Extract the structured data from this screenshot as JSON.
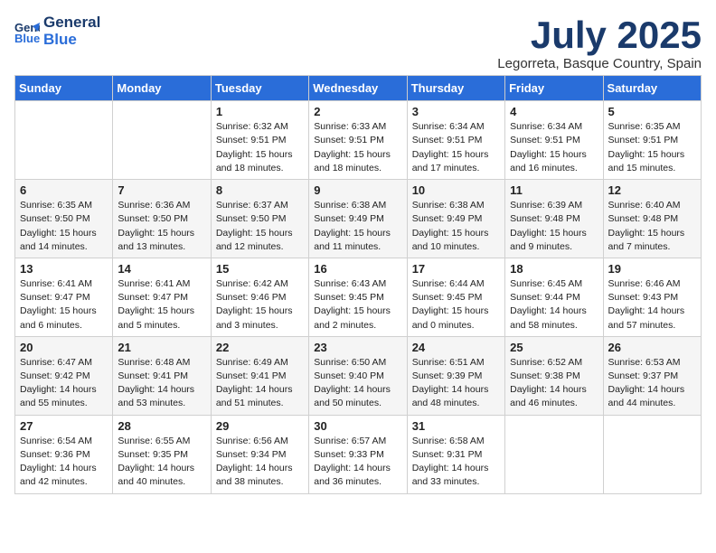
{
  "logo": {
    "line1": "General",
    "line2": "Blue"
  },
  "header": {
    "month": "July 2025",
    "location": "Legorreta, Basque Country, Spain"
  },
  "days_of_week": [
    "Sunday",
    "Monday",
    "Tuesday",
    "Wednesday",
    "Thursday",
    "Friday",
    "Saturday"
  ],
  "weeks": [
    [
      {
        "day": "",
        "info": ""
      },
      {
        "day": "",
        "info": ""
      },
      {
        "day": "1",
        "info": "Sunrise: 6:32 AM\nSunset: 9:51 PM\nDaylight: 15 hours\nand 18 minutes."
      },
      {
        "day": "2",
        "info": "Sunrise: 6:33 AM\nSunset: 9:51 PM\nDaylight: 15 hours\nand 18 minutes."
      },
      {
        "day": "3",
        "info": "Sunrise: 6:34 AM\nSunset: 9:51 PM\nDaylight: 15 hours\nand 17 minutes."
      },
      {
        "day": "4",
        "info": "Sunrise: 6:34 AM\nSunset: 9:51 PM\nDaylight: 15 hours\nand 16 minutes."
      },
      {
        "day": "5",
        "info": "Sunrise: 6:35 AM\nSunset: 9:51 PM\nDaylight: 15 hours\nand 15 minutes."
      }
    ],
    [
      {
        "day": "6",
        "info": "Sunrise: 6:35 AM\nSunset: 9:50 PM\nDaylight: 15 hours\nand 14 minutes."
      },
      {
        "day": "7",
        "info": "Sunrise: 6:36 AM\nSunset: 9:50 PM\nDaylight: 15 hours\nand 13 minutes."
      },
      {
        "day": "8",
        "info": "Sunrise: 6:37 AM\nSunset: 9:50 PM\nDaylight: 15 hours\nand 12 minutes."
      },
      {
        "day": "9",
        "info": "Sunrise: 6:38 AM\nSunset: 9:49 PM\nDaylight: 15 hours\nand 11 minutes."
      },
      {
        "day": "10",
        "info": "Sunrise: 6:38 AM\nSunset: 9:49 PM\nDaylight: 15 hours\nand 10 minutes."
      },
      {
        "day": "11",
        "info": "Sunrise: 6:39 AM\nSunset: 9:48 PM\nDaylight: 15 hours\nand 9 minutes."
      },
      {
        "day": "12",
        "info": "Sunrise: 6:40 AM\nSunset: 9:48 PM\nDaylight: 15 hours\nand 7 minutes."
      }
    ],
    [
      {
        "day": "13",
        "info": "Sunrise: 6:41 AM\nSunset: 9:47 PM\nDaylight: 15 hours\nand 6 minutes."
      },
      {
        "day": "14",
        "info": "Sunrise: 6:41 AM\nSunset: 9:47 PM\nDaylight: 15 hours\nand 5 minutes."
      },
      {
        "day": "15",
        "info": "Sunrise: 6:42 AM\nSunset: 9:46 PM\nDaylight: 15 hours\nand 3 minutes."
      },
      {
        "day": "16",
        "info": "Sunrise: 6:43 AM\nSunset: 9:45 PM\nDaylight: 15 hours\nand 2 minutes."
      },
      {
        "day": "17",
        "info": "Sunrise: 6:44 AM\nSunset: 9:45 PM\nDaylight: 15 hours\nand 0 minutes."
      },
      {
        "day": "18",
        "info": "Sunrise: 6:45 AM\nSunset: 9:44 PM\nDaylight: 14 hours\nand 58 minutes."
      },
      {
        "day": "19",
        "info": "Sunrise: 6:46 AM\nSunset: 9:43 PM\nDaylight: 14 hours\nand 57 minutes."
      }
    ],
    [
      {
        "day": "20",
        "info": "Sunrise: 6:47 AM\nSunset: 9:42 PM\nDaylight: 14 hours\nand 55 minutes."
      },
      {
        "day": "21",
        "info": "Sunrise: 6:48 AM\nSunset: 9:41 PM\nDaylight: 14 hours\nand 53 minutes."
      },
      {
        "day": "22",
        "info": "Sunrise: 6:49 AM\nSunset: 9:41 PM\nDaylight: 14 hours\nand 51 minutes."
      },
      {
        "day": "23",
        "info": "Sunrise: 6:50 AM\nSunset: 9:40 PM\nDaylight: 14 hours\nand 50 minutes."
      },
      {
        "day": "24",
        "info": "Sunrise: 6:51 AM\nSunset: 9:39 PM\nDaylight: 14 hours\nand 48 minutes."
      },
      {
        "day": "25",
        "info": "Sunrise: 6:52 AM\nSunset: 9:38 PM\nDaylight: 14 hours\nand 46 minutes."
      },
      {
        "day": "26",
        "info": "Sunrise: 6:53 AM\nSunset: 9:37 PM\nDaylight: 14 hours\nand 44 minutes."
      }
    ],
    [
      {
        "day": "27",
        "info": "Sunrise: 6:54 AM\nSunset: 9:36 PM\nDaylight: 14 hours\nand 42 minutes."
      },
      {
        "day": "28",
        "info": "Sunrise: 6:55 AM\nSunset: 9:35 PM\nDaylight: 14 hours\nand 40 minutes."
      },
      {
        "day": "29",
        "info": "Sunrise: 6:56 AM\nSunset: 9:34 PM\nDaylight: 14 hours\nand 38 minutes."
      },
      {
        "day": "30",
        "info": "Sunrise: 6:57 AM\nSunset: 9:33 PM\nDaylight: 14 hours\nand 36 minutes."
      },
      {
        "day": "31",
        "info": "Sunrise: 6:58 AM\nSunset: 9:31 PM\nDaylight: 14 hours\nand 33 minutes."
      },
      {
        "day": "",
        "info": ""
      },
      {
        "day": "",
        "info": ""
      }
    ]
  ]
}
